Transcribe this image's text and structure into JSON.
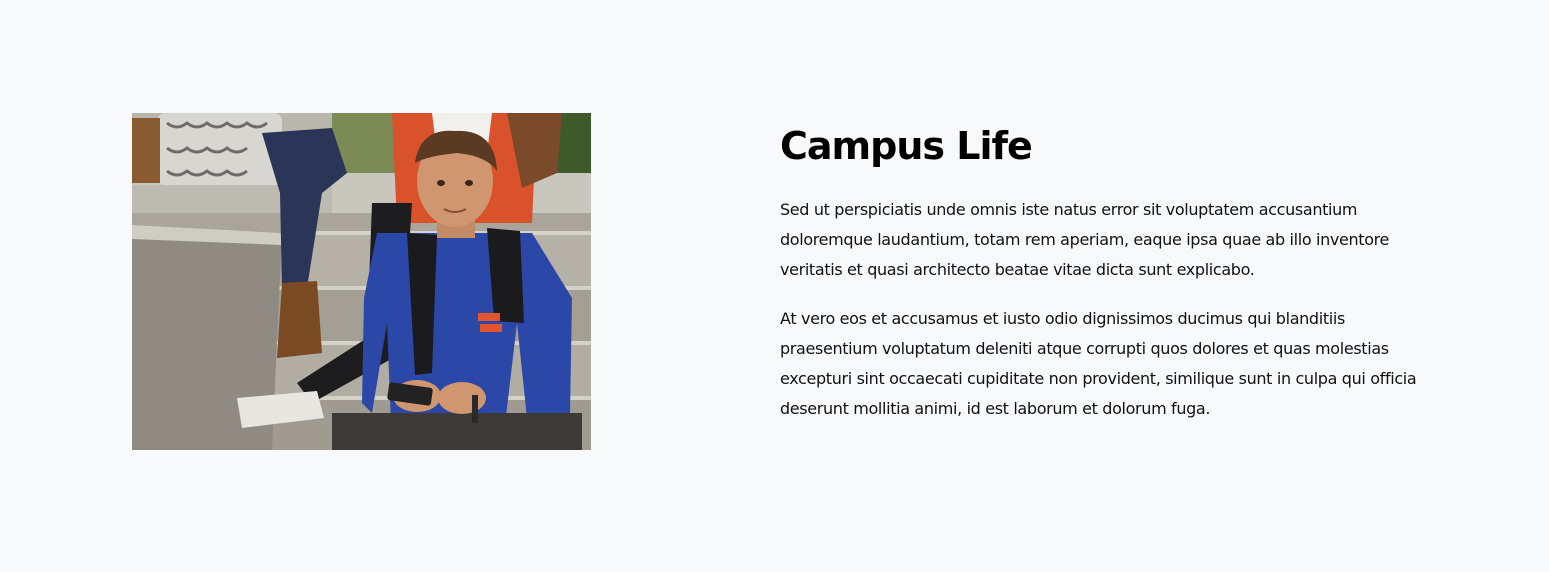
{
  "section": {
    "title": "Campus Life",
    "paragraphs": [
      "Sed ut perspiciatis unde omnis iste natus error sit voluptatem accusantium doloremque laudantium, totam rem aperiam, eaque ipsa quae ab illo inventore veritatis et quasi architecto beatae vitae dicta sunt explicabo.",
      "At vero eos et accusamus et iusto odio dignissimos ducimus qui blanditiis praesentium voluptatum deleniti atque corrupti quos dolores et quas molestias excepturi sint occaecati cupiditate non provident, similique sunt in culpa qui officia deserunt mollitia animi, id est laborum et dolorum fuga."
    ]
  },
  "colors": {
    "background": "#f8f9fb",
    "title": "#000000",
    "text": "#111111",
    "shirt": "#2b47a8",
    "orange": "#e2542b"
  }
}
